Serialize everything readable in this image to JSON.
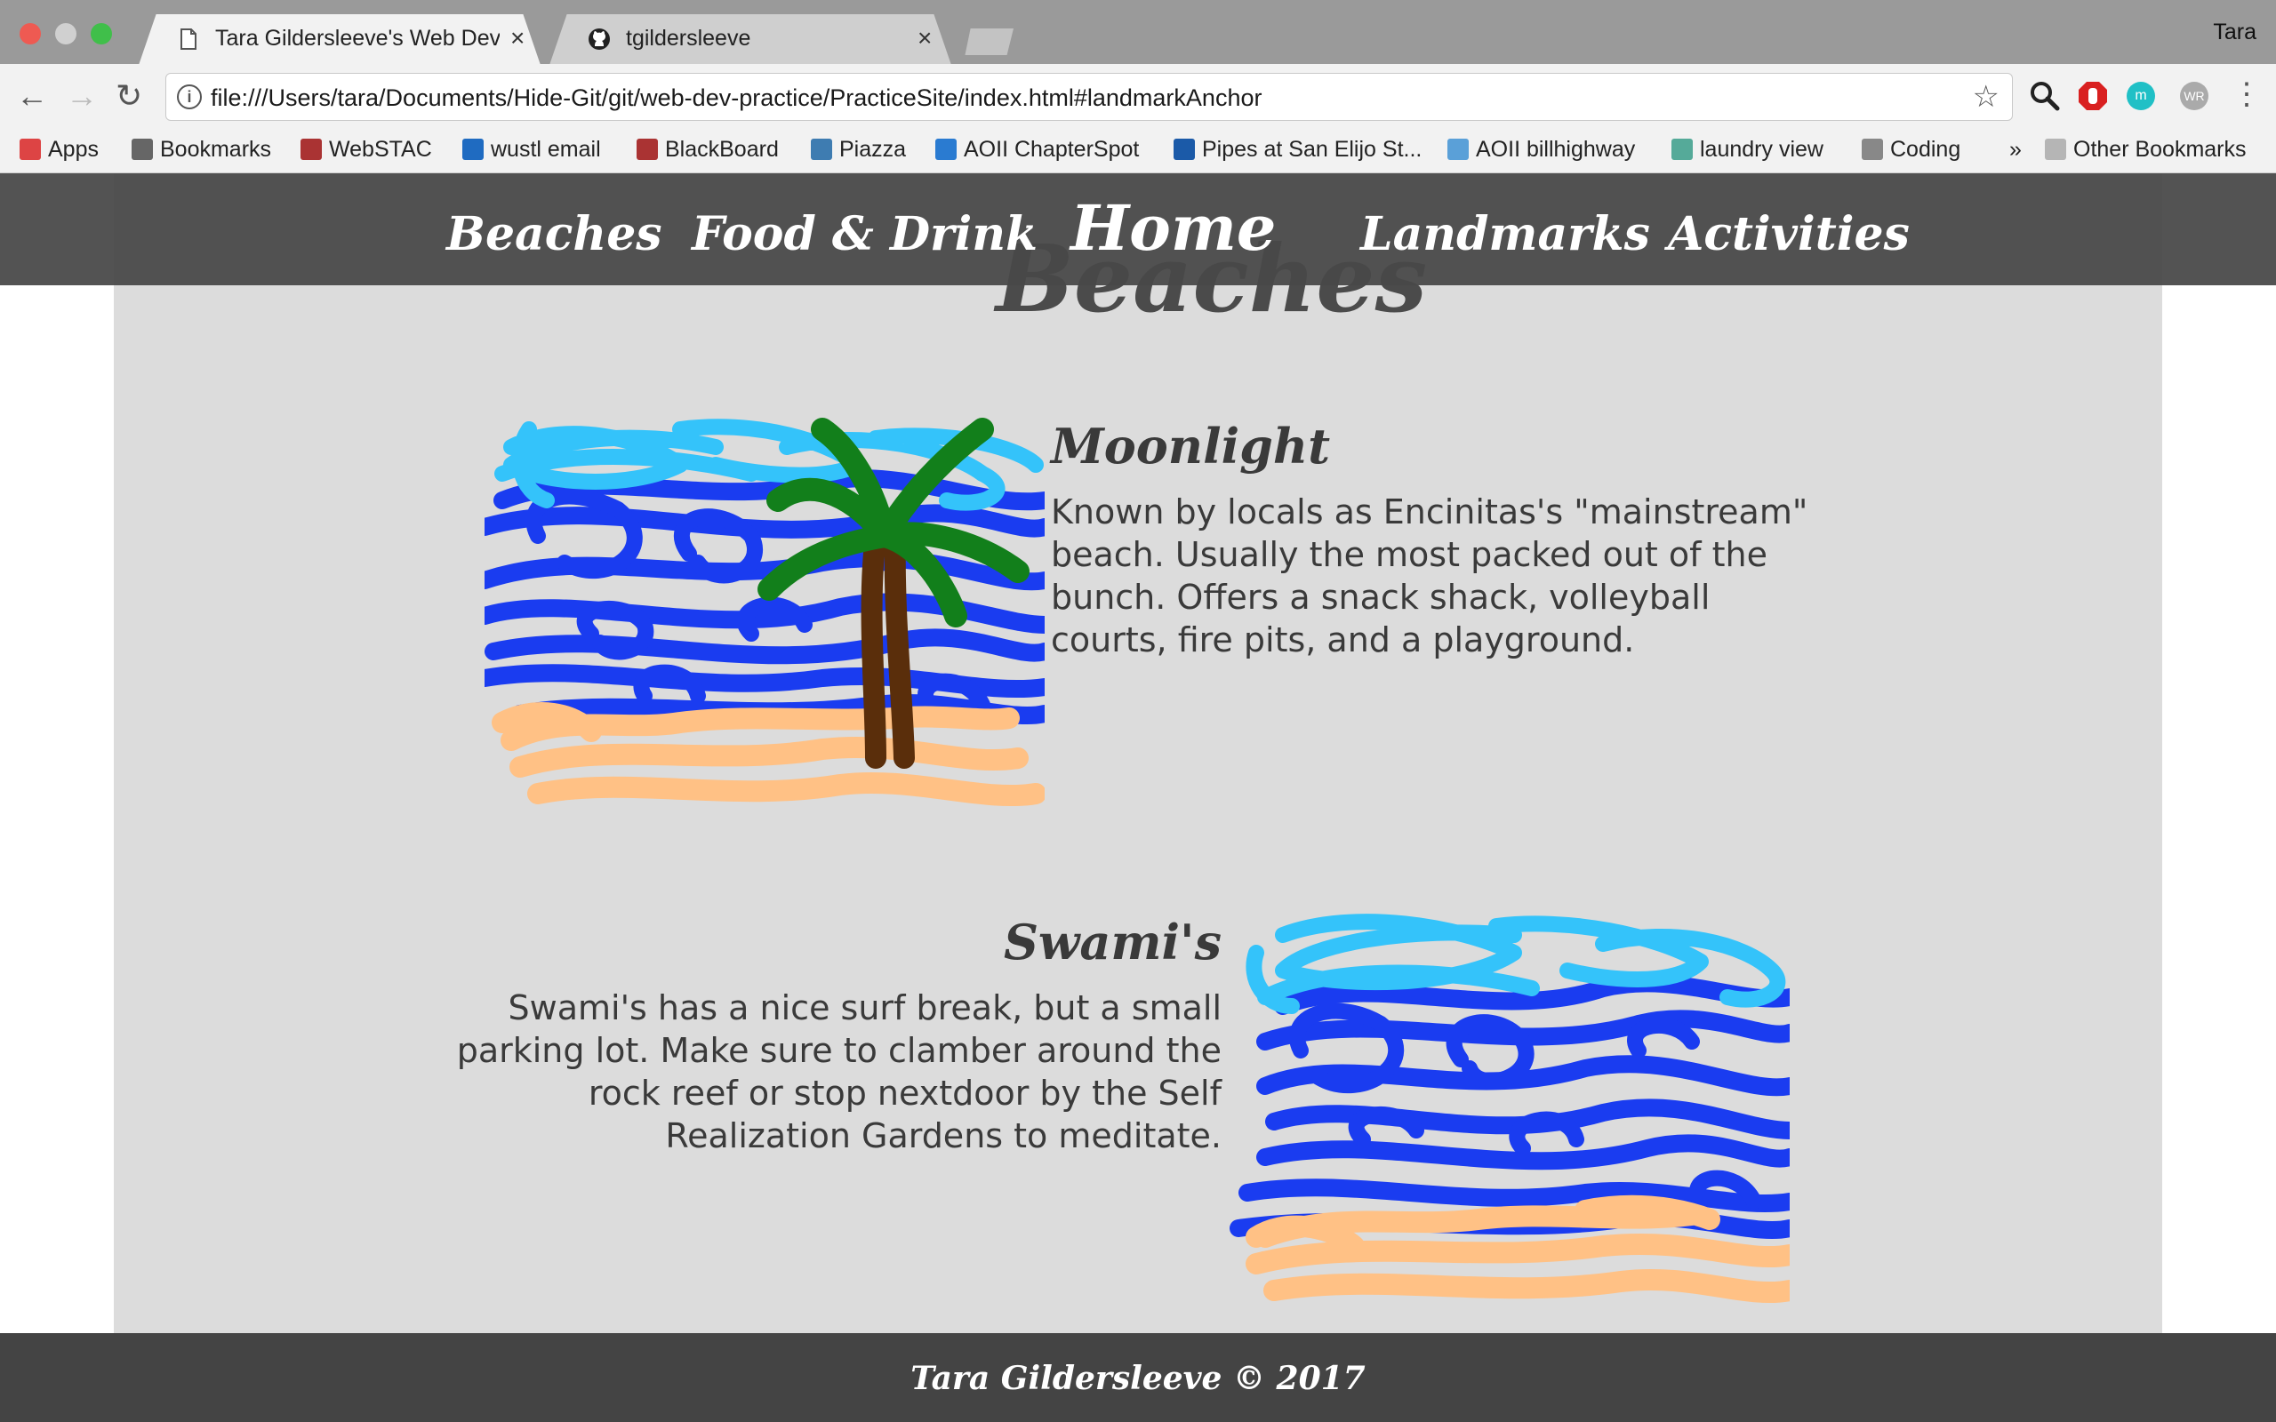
{
  "browser": {
    "tabs": [
      {
        "title": "Tara Gildersleeve's Web Dev P",
        "active": true
      },
      {
        "title": "tgildersleeve",
        "active": false
      }
    ],
    "close_glyph": "×",
    "profile_name": "Tara",
    "url": "file:///Users/tara/Documents/Hide-Git/git/web-dev-practice/PracticeSite/index.html#landmarkAnchor",
    "nav_glyphs": {
      "back": "←",
      "forward": "→",
      "reload": "↻",
      "star": "☆",
      "search": "⚲",
      "menu": "⋮"
    },
    "ext_labels": {
      "m": "m",
      "wr": "WR"
    },
    "bookmarks": [
      {
        "label": "Apps",
        "icon": "apps-grid-icon",
        "color": "#d44"
      },
      {
        "label": "Bookmarks",
        "icon": "star-icon",
        "color": "#666"
      },
      {
        "label": "WebSTAC",
        "icon": "webstac-icon",
        "color": "#a33"
      },
      {
        "label": "wustl email",
        "icon": "outlook-icon",
        "color": "#1f6bc1"
      },
      {
        "label": "BlackBoard",
        "icon": "blackboard-icon",
        "color": "#a33"
      },
      {
        "label": "Piazza",
        "icon": "piazza-icon",
        "color": "#3e7cb1"
      },
      {
        "label": "AOII ChapterSpot",
        "icon": "chapterspot-icon",
        "color": "#2a7bd1"
      },
      {
        "label": "Pipes at San Elijo St...",
        "icon": "surfline-icon",
        "color": "#1b5aa8"
      },
      {
        "label": "AOII billhighway",
        "icon": "billhighway-icon",
        "color": "#5aa0d8"
      },
      {
        "label": "laundry view",
        "icon": "laundry-icon",
        "color": "#5a9"
      },
      {
        "label": "Coding",
        "icon": "folder-icon",
        "color": "#888"
      }
    ],
    "overflow": "»",
    "other_bookmarks": "Other Bookmarks"
  },
  "site": {
    "nav": {
      "beaches": "Beaches",
      "food": "Food & Drink",
      "home": "Home",
      "landmarks": "Landmarks",
      "activities": "Activities"
    },
    "section_title": "Beaches",
    "beaches": [
      {
        "name": "Moonlight",
        "description": "Known by locals as Encinitas's \"mainstream\" beach. Usually the most packed out of the bunch. Offers a snack shack, volleyball courts, fire pits, and a playground."
      },
      {
        "name": "Swami's",
        "description": "Swami's has a nice surf break, but a small parking lot. Make sure to clamber around the rock reef or stop nextdoor by the Self Realization Gardens to meditate."
      }
    ],
    "footer": "Tara Gildersleeve © 2017"
  },
  "colors": {
    "panel": "#dcdcdc",
    "navbar": "#484848",
    "footer": "#444444",
    "sea_blue": "#1a3cf0",
    "sky_blue": "#34c3fa",
    "sand": "#ffc185",
    "palm_green": "#127f1b",
    "trunk": "#5a2e0b"
  }
}
